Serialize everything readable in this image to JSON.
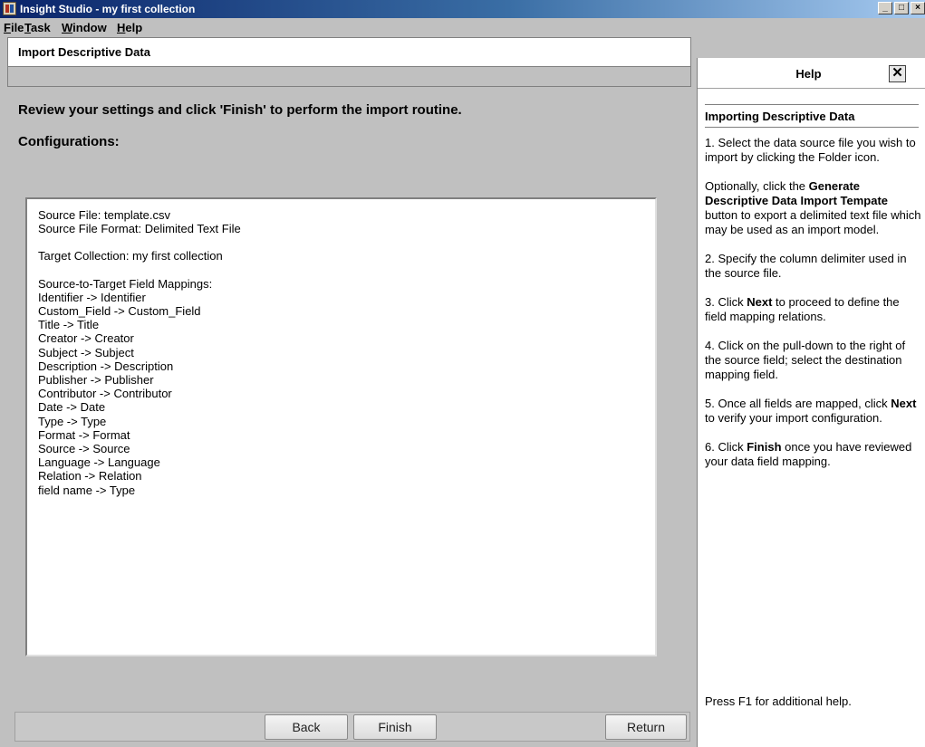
{
  "window": {
    "title": "Insight Studio - my first collection",
    "controls": [
      "_",
      "□",
      "×"
    ]
  },
  "menu": {
    "items": [
      "File",
      "Task",
      "Window",
      "Help"
    ]
  },
  "wizard": {
    "title": "Import Descriptive Data",
    "instruction": "Review your settings and click 'Finish' to perform the import routine.",
    "configurations_label": "Configurations:",
    "summary": {
      "source_file": "Source File: template.csv",
      "source_format": "Source File Format: Delimited Text File",
      "target_collection": "Target Collection: my first collection",
      "mappings_header": "Source-to-Target Field Mappings:",
      "mappings": [
        "Identifier -> Identifier",
        "Custom_Field -> Custom_Field",
        "Title -> Title",
        "Creator -> Creator",
        "Subject -> Subject",
        "Description -> Description",
        "Publisher -> Publisher",
        "Contributor -> Contributor",
        "Date -> Date",
        "Type -> Type",
        "Format -> Format",
        "Source -> Source",
        "Language -> Language",
        "Relation -> Relation",
        "field name -> Type"
      ]
    },
    "buttons": {
      "back": "Back",
      "finish": "Finish",
      "return": "Return"
    }
  },
  "help": {
    "header": "Help",
    "close": "✕",
    "subtitle": "Importing Descriptive Data",
    "step1": "1. Select the data source file you wish to import by clicking the Folder icon.",
    "optional_prefix": "Optionally, click the ",
    "optional_bold": "Generate Descriptive Data Import Tempate",
    "optional_suffix": " button to export a delimited text file which may be used as an import model.",
    "step2": "2. Specify the column delimiter used in the source file.",
    "step3_prefix": "3. Click ",
    "step3_bold": "Next",
    "step3_suffix": " to proceed to define the field mapping relations.",
    "step4": "4. Click on the pull-down to the right of the source field; select the destination mapping field.",
    "step5_prefix": "5. Once all fields are mapped, click ",
    "step5_bold": "Next",
    "step5_suffix": " to verify your import configuration.",
    "step6_prefix": "6. Click ",
    "step6_bold": "Finish",
    "step6_suffix": " once you have reviewed your data field mapping.",
    "footer": "Press F1 for additional help."
  }
}
